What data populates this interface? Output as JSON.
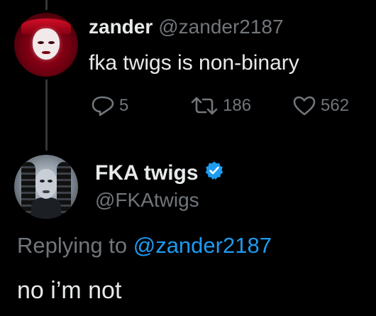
{
  "tweet1": {
    "display_name": "zander",
    "handle": "@zander2187",
    "text": "fka twigs is non-binary",
    "replies": "5",
    "retweets": "186",
    "likes": "562",
    "icons": {
      "reply": "reply-icon",
      "retweet": "retweet-icon",
      "like": "heart-icon"
    }
  },
  "tweet2": {
    "display_name": "FKA twigs",
    "handle": "@FKAtwigs",
    "verified": true,
    "replying_prefix": "Replying to",
    "replying_to": "@zander2187",
    "text": "no i’m not"
  },
  "colors": {
    "background": "#000000",
    "text": "#e7e9ea",
    "muted": "#71767b",
    "accent": "#1d9bf0"
  }
}
